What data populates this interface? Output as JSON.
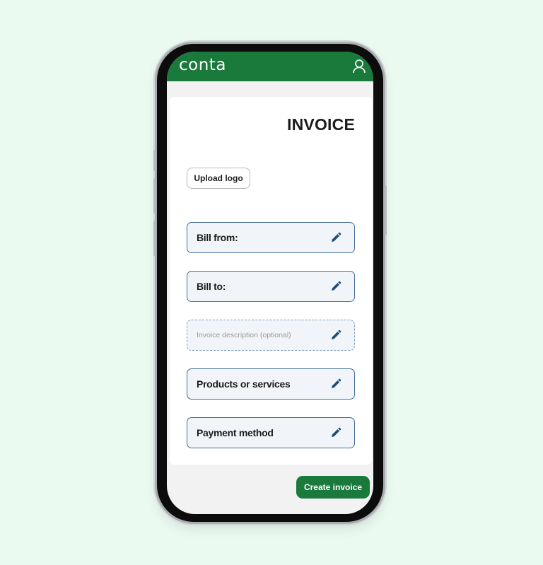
{
  "app": {
    "logo_text": "conta"
  },
  "header": {
    "user_icon": "user-icon"
  },
  "invoice": {
    "title": "INVOICE",
    "upload_logo_label": "Upload logo",
    "fields": [
      {
        "label": "Bill from:",
        "icon": "pencil-icon"
      },
      {
        "label": "Bill to:",
        "icon": "pencil-icon"
      },
      {
        "label": "Invoice description (optional)",
        "icon": "pencil-icon"
      },
      {
        "label": "Products or services",
        "icon": "pencil-icon"
      },
      {
        "label": "Payment method",
        "icon": "pencil-icon"
      }
    ]
  },
  "footer": {
    "create_invoice_label": "Create invoice"
  },
  "colors": {
    "brand_green": "#1a7a3c",
    "field_border": "#3f6b9a",
    "field_bg": "#f1f5f9",
    "pencil": "#1e4d7b",
    "page_bg": "#eafaf0"
  }
}
